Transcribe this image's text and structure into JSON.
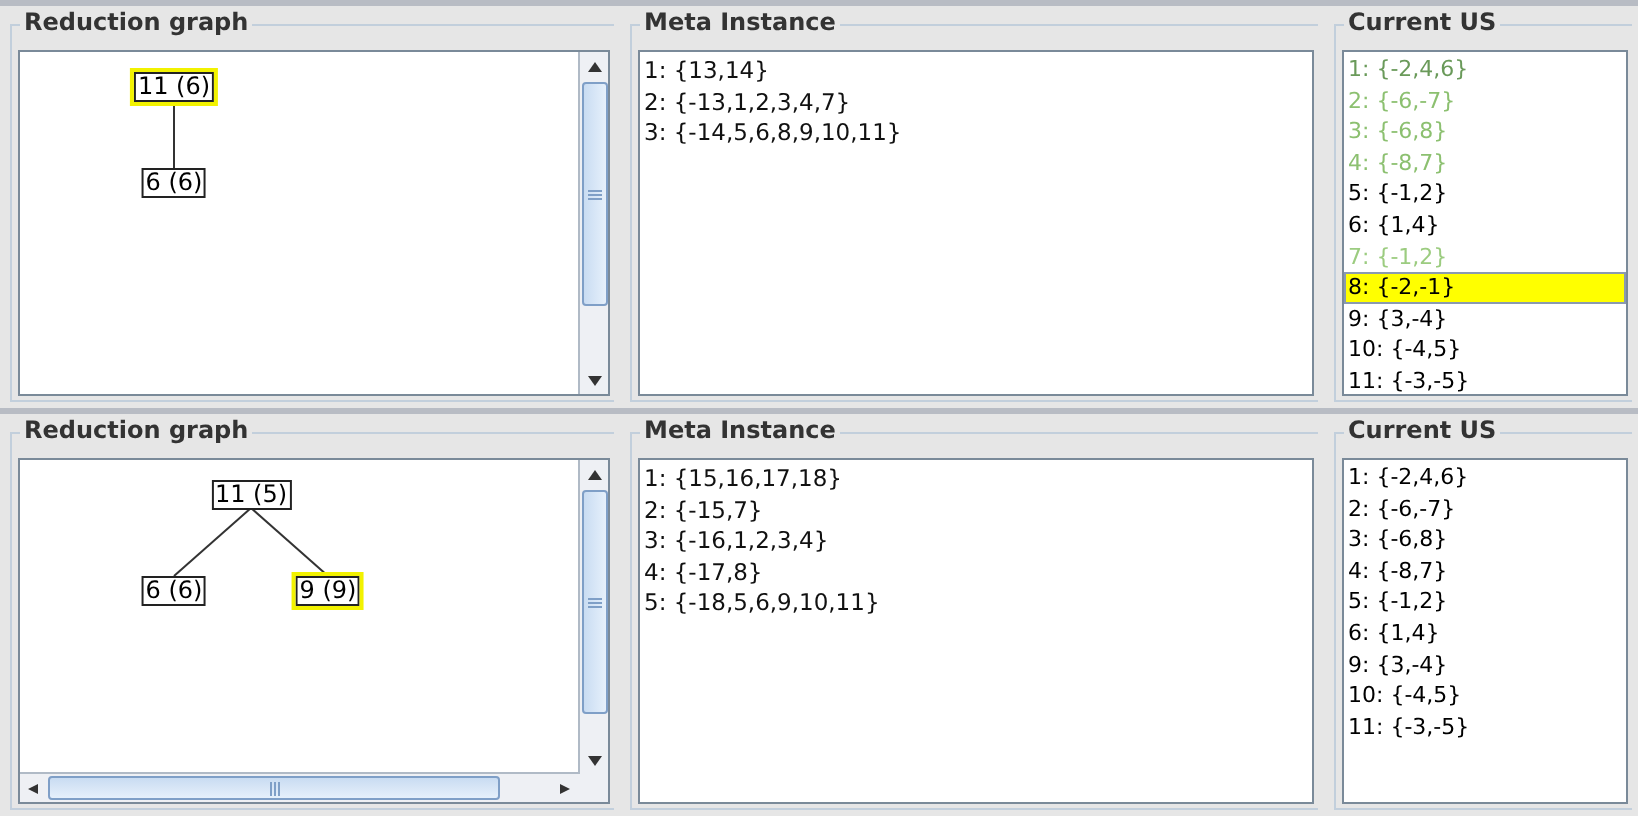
{
  "views": [
    {
      "reduction_graph": {
        "title": "Reduction graph",
        "horizontal_scrollbar": false,
        "tree": {
          "label": "11 (6)",
          "highlighted": true,
          "children": [
            {
              "label": "6 (6)",
              "highlighted": false
            }
          ]
        }
      },
      "meta_instance": {
        "title": "Meta Instance",
        "lines": [
          "1: {13,14}",
          "2: {-13,1,2,3,4,7}",
          "3: {-14,5,6,8,9,10,11}"
        ]
      },
      "current_us": {
        "title": "Current US",
        "items": [
          {
            "text": "1: {-2,4,6}",
            "color": "#6a9a5a",
            "selected": false
          },
          {
            "text": "2: {-6,-7}",
            "color": "#8cc070",
            "selected": false
          },
          {
            "text": "3: {-6,8}",
            "color": "#8cc070",
            "selected": false
          },
          {
            "text": "4: {-8,7}",
            "color": "#8cc070",
            "selected": false
          },
          {
            "text": "5: {-1,2}",
            "color": "#000000",
            "selected": false
          },
          {
            "text": "6: {1,4}",
            "color": "#000000",
            "selected": false
          },
          {
            "text": "7: {-1,2}",
            "color": "#9ccc80",
            "selected": false
          },
          {
            "text": "8: {-2,-1}",
            "selected": true
          },
          {
            "text": "9: {3,-4}",
            "color": "#000000",
            "selected": false
          },
          {
            "text": "10: {-4,5}",
            "color": "#000000",
            "selected": false
          },
          {
            "text": "11: {-3,-5}",
            "color": "#000000",
            "selected": false
          }
        ]
      }
    },
    {
      "reduction_graph": {
        "title": "Reduction graph",
        "horizontal_scrollbar": true,
        "tree": {
          "label": "11 (5)",
          "highlighted": false,
          "children": [
            {
              "label": "6 (6)",
              "highlighted": false
            },
            {
              "label": "9 (9)",
              "highlighted": true
            }
          ]
        }
      },
      "meta_instance": {
        "title": "Meta Instance",
        "lines": [
          "1: {15,16,17,18}",
          "2: {-15,7}",
          "3: {-16,1,2,3,4}",
          "4: {-17,8}",
          "5: {-18,5,6,9,10,11}"
        ]
      },
      "current_us": {
        "title": "Current US",
        "items": [
          {
            "text": "1: {-2,4,6}",
            "color": "#000000",
            "selected": false
          },
          {
            "text": "2: {-6,-7}",
            "color": "#000000",
            "selected": false
          },
          {
            "text": "3: {-6,8}",
            "color": "#000000",
            "selected": false
          },
          {
            "text": "4: {-8,7}",
            "color": "#000000",
            "selected": false
          },
          {
            "text": "5: {-1,2}",
            "color": "#000000",
            "selected": false
          },
          {
            "text": "6: {1,4}",
            "color": "#000000",
            "selected": false
          },
          {
            "text": "9: {3,-4}",
            "color": "#000000",
            "selected": false
          },
          {
            "text": "10: {-4,5}",
            "color": "#000000",
            "selected": false
          },
          {
            "text": "11: {-3,-5}",
            "color": "#000000",
            "selected": false
          }
        ]
      }
    }
  ]
}
